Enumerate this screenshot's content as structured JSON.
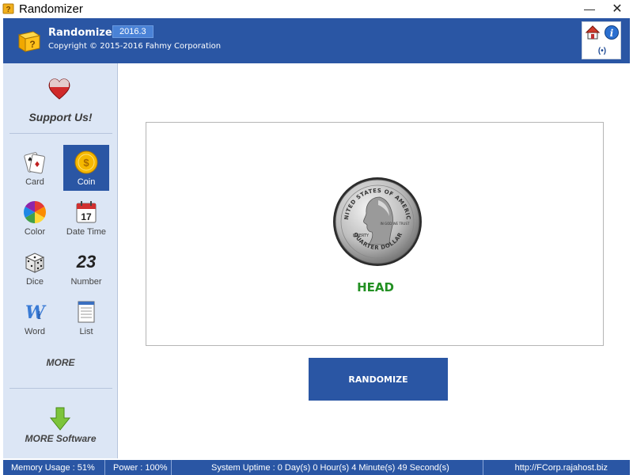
{
  "window": {
    "title": "Randomizer",
    "minimize_glyph": "—",
    "close_glyph": "✕"
  },
  "header": {
    "app_name": "Randomizer",
    "version": "2016.3",
    "copyright": "Copyright © 2015-2016 Fahmy Corporation",
    "radio_label": "(•)",
    "icons": [
      "home-icon",
      "info-icon",
      "radio-icon"
    ]
  },
  "sidebar": {
    "support_label": "Support Us!",
    "tools": [
      {
        "label": "Card",
        "icon": "playing-cards-icon",
        "selected": false
      },
      {
        "label": "Coin",
        "icon": "coin-icon",
        "selected": true
      },
      {
        "label": "Color",
        "icon": "color-wheel-icon",
        "selected": false
      },
      {
        "label": "Date Time",
        "icon": "calendar-icon",
        "selected": false
      },
      {
        "label": "Dice",
        "icon": "dice-icon",
        "selected": false
      },
      {
        "label": "Number",
        "icon": "number-icon",
        "selected": false
      },
      {
        "label": "Word",
        "icon": "word-icon",
        "selected": false
      },
      {
        "label": "List",
        "icon": "list-icon",
        "selected": false
      }
    ],
    "number_glyph": "23",
    "calendar_day": "17",
    "more_label": "MORE",
    "more_software_label": "MORE Software"
  },
  "main": {
    "result": "HEAD",
    "coin_text": {
      "top": "UNITED STATES OF AMERICA",
      "bottom": "QUARTER DOLLAR",
      "liberty": "LIBERTY",
      "motto": "IN GOD WE TRUST"
    },
    "randomize_label": "RANDOMIZE"
  },
  "status": {
    "memory": "Memory Usage : 51%",
    "power": "Power : 100%",
    "uptime": "System Uptime : 0 Day(s) 0 Hour(s) 4 Minute(s) 49 Second(s)",
    "url": "http://FCorp.rajahost.biz"
  },
  "colors": {
    "brand_blue": "#2a56a4",
    "sidebar_bg": "#dce6f5",
    "result_green": "#239023"
  }
}
